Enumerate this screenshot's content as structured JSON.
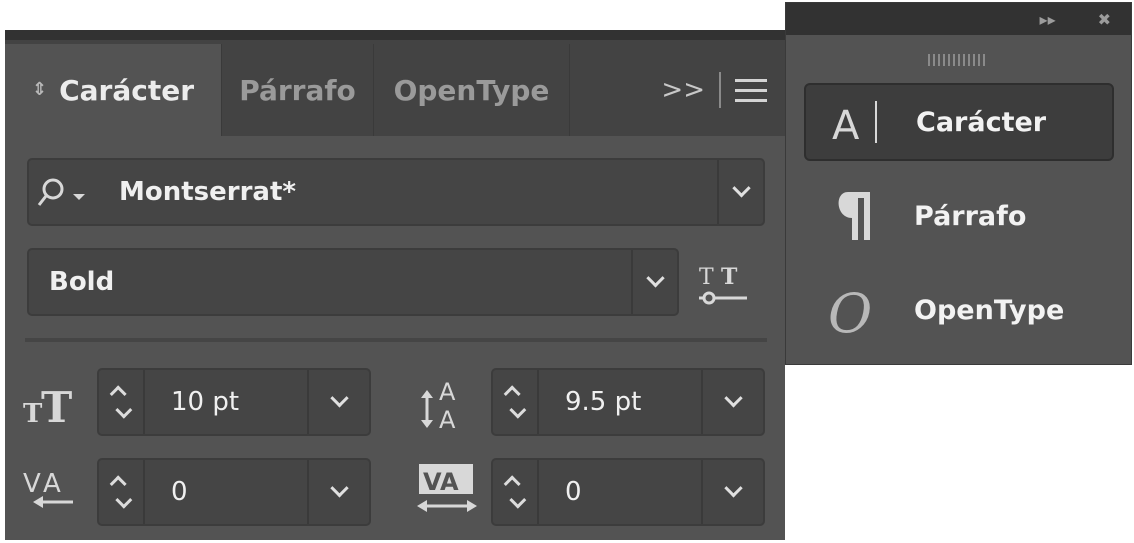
{
  "panel": {
    "tabs": [
      {
        "label": "Carácter",
        "active": true
      },
      {
        "label": "Párrafo",
        "active": false
      },
      {
        "label": "OpenType",
        "active": false
      }
    ],
    "tab_overflow_label": ">>",
    "font_search": {
      "value": "Montserrat*",
      "icon": "search-icon"
    },
    "font_style": {
      "value": "Bold"
    },
    "font_size": {
      "value": "10 pt",
      "icon": "font-size-icon"
    },
    "leading": {
      "value": "9.5 pt",
      "icon": "leading-icon"
    },
    "kerning": {
      "value": "0",
      "icon": "kerning-icon"
    },
    "tracking": {
      "value": "0",
      "icon": "tracking-icon"
    }
  },
  "dock": {
    "items": [
      {
        "label": "Carácter",
        "icon": "character-icon",
        "selected": true
      },
      {
        "label": "Párrafo",
        "icon": "paragraph-icon",
        "selected": false
      },
      {
        "label": "OpenType",
        "icon": "opentype-icon",
        "selected": false
      }
    ]
  },
  "colors": {
    "panel_bg": "#535353",
    "field_bg": "#454545",
    "tabbar_bg": "#434343",
    "header_bg": "#323232",
    "text": "#f0f0f0"
  }
}
